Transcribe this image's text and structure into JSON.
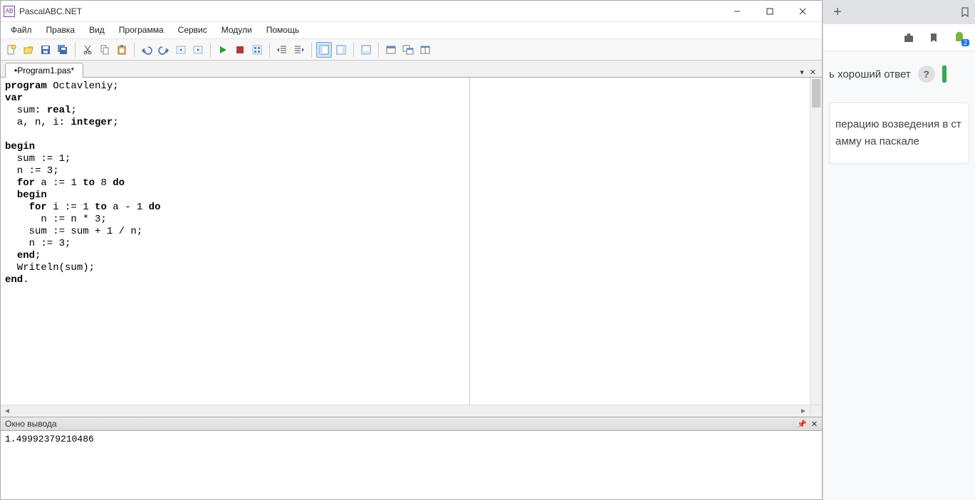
{
  "window": {
    "title": "PascalABC.NET",
    "app_icon_label": "AB"
  },
  "menu": {
    "items": [
      "Файл",
      "Правка",
      "Вид",
      "Программа",
      "Сервис",
      "Модули",
      "Помощь"
    ]
  },
  "toolbar": {
    "buttons": [
      {
        "name": "new-file-icon",
        "title": "New"
      },
      {
        "name": "open-file-icon",
        "title": "Open"
      },
      {
        "name": "save-icon",
        "title": "Save"
      },
      {
        "name": "save-all-icon",
        "title": "Save All"
      },
      {
        "sep": true
      },
      {
        "name": "cut-icon",
        "title": "Cut"
      },
      {
        "name": "copy-icon",
        "title": "Copy"
      },
      {
        "name": "paste-icon",
        "title": "Paste"
      },
      {
        "sep": true
      },
      {
        "name": "undo-icon",
        "title": "Undo"
      },
      {
        "name": "redo-icon",
        "title": "Redo"
      },
      {
        "name": "nav-back-icon",
        "title": "Back"
      },
      {
        "name": "nav-forward-icon",
        "title": "Forward"
      },
      {
        "sep": true
      },
      {
        "name": "run-icon",
        "title": "Run",
        "color": "#2e9b2e"
      },
      {
        "name": "stop-icon",
        "title": "Stop",
        "color": "#b33"
      },
      {
        "name": "compile-icon",
        "title": "Compile"
      },
      {
        "sep": true
      },
      {
        "name": "indent-left-icon",
        "title": "Outdent"
      },
      {
        "name": "indent-right-icon",
        "title": "Indent"
      },
      {
        "sep": true
      },
      {
        "name": "panel1-icon",
        "title": "Panel",
        "active": true
      },
      {
        "name": "panel2-icon",
        "title": "Panel"
      },
      {
        "sep": true
      },
      {
        "name": "panel3-icon",
        "title": "Panel"
      },
      {
        "sep": true
      },
      {
        "name": "window1-icon",
        "title": "Window"
      },
      {
        "name": "window2-icon",
        "title": "Window"
      },
      {
        "name": "window3-icon",
        "title": "Window"
      }
    ]
  },
  "tabs": {
    "items": [
      {
        "label": "•Program1.pas*"
      }
    ]
  },
  "code": {
    "text": "program Octavleniy;\nvar\n  sum: real;\n  a, n, i: integer;\n\nbegin\n  sum := 1;\n  n := 3;\n  for a := 1 to 8 do\n  begin\n    for i := 1 to a - 1 do\n      n := n * 3;\n    sum := sum + 1 / n;\n    n := 3;\n  end;\n  Writeln(sum);\nend."
  },
  "output": {
    "title": "Окно вывода",
    "text": "1.49992379210486"
  },
  "browser": {
    "hint_text": "ь хороший ответ",
    "question_line1": "перацию возведения в ст",
    "question_line2": "амму на паскале",
    "ext_badge": "2"
  }
}
